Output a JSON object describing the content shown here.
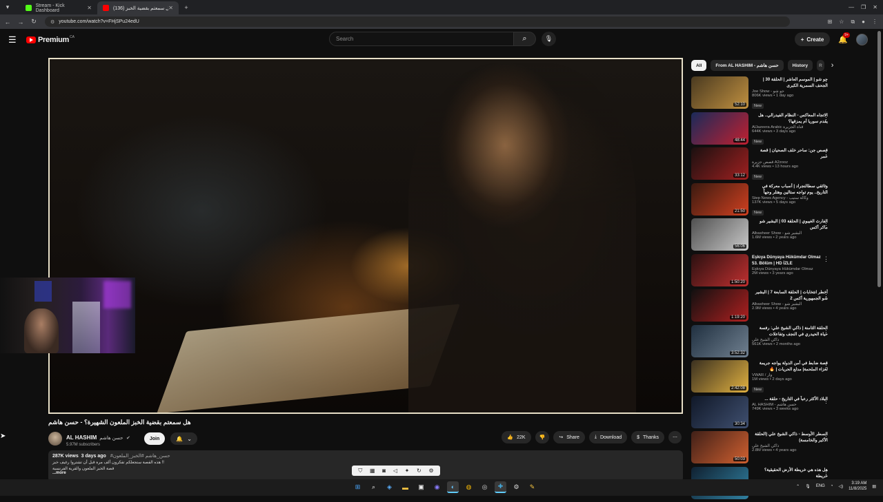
{
  "browser": {
    "tabs": [
      {
        "label": "Stream - Kick Dashboard",
        "active": false,
        "color": "#53fc18"
      },
      {
        "label": "(136) هل سمعتم بقضية الخبز ...",
        "active": true,
        "color": "#ff0000"
      }
    ],
    "url": "youtube.com/watch?v=FHjSPu24edU",
    "new_tab": "+"
  },
  "header": {
    "logo_text": "Premium",
    "logo_country": "CA",
    "search_placeholder": "Search",
    "create_label": "Create",
    "notifications_badge": "9+"
  },
  "video": {
    "title": "هل سمعتم بقضية الخبز الملعون الشهيرة؟ - حسن هاشم",
    "channel_name": "AL HASHIM",
    "channel_alt_name": "حسن هاشم",
    "subscribers": "5.97M subscribers",
    "join_label": "Join",
    "likes": "22K",
    "share_label": "Share",
    "download_label": "Download",
    "thanks_label": "Thanks",
    "views": "287K views",
    "age": "3 days ago",
    "tags": "#حسن_هاشم #الخبز_الملعون",
    "desc_line1": "هذه القصة ستجعلكم تفكرون ألف مرة قبل أن تشتروا رغيف خبز !!",
    "desc_line2": "قصة الخبز الملعون والقرية الفرنسية",
    "more_label": "...more"
  },
  "chips": [
    "All",
    "From AL HASHIM - حسن هاشم",
    "History",
    "R"
  ],
  "recommendations": [
    {
      "title": "جو شو | الموسم العاشر | الحلقة 30 | الجحف السمرية الكبرى",
      "channel": "Joe Show - جو شو",
      "meta": "806K views • 1 day ago",
      "duration": "52:10",
      "new": true,
      "thumb": [
        "#4a3a20",
        "#c09040"
      ]
    },
    {
      "title": "الاتجاه المعاكس - النظام الفيدرالي.. هل يقدم سوريا أم يمزقها؟",
      "channel": "AlJazeera Arabic قناة الجزيرة",
      "meta": "644K views • 3 days ago",
      "duration": "48:44",
      "new": true,
      "thumb": [
        "#1a2a5a",
        "#c02030"
      ]
    },
    {
      "title": "قصص جن: ساحر خلف الصحيان | قصة عمر",
      "channel": "قصص جزيرة A2zooz",
      "meta": "4.4K views • 13 hours ago",
      "duration": "33:12",
      "new": true,
      "thumb": [
        "#1a1010",
        "#a02020"
      ]
    },
    {
      "title": "وثائقي سطالنجراد | أسباب معركة في التاريخ.. يوم تواجه ستالين وهتلر وجهاً",
      "channel": "Step News Agency - وكالة ستيب",
      "meta": "137K views • 5 days ago",
      "duration": "21:50",
      "new": true,
      "thumb": [
        "#3a1a10",
        "#d04020"
      ]
    },
    {
      "title": "الفارث الغيبوي | الحلقة 03 | البشير شو ماكر أكس",
      "channel": "Albasheer Show - البشير شو",
      "meta": "1.6M views • 2 years ago",
      "duration": "56:06",
      "new": false,
      "thumb": [
        "#505050",
        "#c8c8c8"
      ]
    },
    {
      "title": "Eşkıya Dünyaya Hükümdar Olmaz 53. Bölüm | HD İZLE",
      "channel": "Eşkıya Dünyaya Hükümdar Olmaz",
      "meta": "2M views • 3 years ago",
      "duration": "1:50:20",
      "new": false,
      "thumb": [
        "#2a1010",
        "#c03030"
      ]
    },
    {
      "title": "أخطر انتخابات | الحلقة السابعة 7 | البشير شو الجمهورية أكس 2",
      "channel": "Albasheer Show - البشير شو",
      "meta": "2.9M views • 4 years ago",
      "duration": "1:19:20",
      "new": false,
      "thumb": [
        "#101010",
        "#b02020"
      ]
    },
    {
      "title": "الحلقة الثامنة | ذاكي الشيخ علي: رفسة حياة الحيدري في النجف وتفاعلات المعارضة العراقية",
      "channel": "ذاكي الشيخ علي",
      "meta": "561K views • 2 months ago",
      "duration": "3:52:32",
      "new": false,
      "thumb": [
        "#203040",
        "#708090"
      ]
    },
    {
      "title": "قصة ضابط في أمن الدولة يواجه جريمة لغزاء الملحمة| مدلع الحريات | 🔥",
      "channel": "VWAR / وار",
      "meta": "1M views • 2 days ago",
      "duration": "2:42:08",
      "new": true,
      "thumb": [
        "#3a3020",
        "#e0b040"
      ]
    },
    {
      "title": "البلاد الأكثر رعباً في التاريخ - حلقة ...",
      "channel": "AL HASHIM - حسن هاشم",
      "meta": "749K views • 3 weeks ago",
      "duration": "30:34",
      "new": false,
      "thumb": [
        "#101828",
        "#405070"
      ]
    },
    {
      "title": "السطر الأوسط - ذاكي الشيخ علي (الحلقة الأكبر والخامسة)",
      "channel": "ذاكي الشيخ علي",
      "meta": "2.8M views • 4 years ago",
      "duration": "50:03",
      "new": false,
      "thumb": [
        "#402018",
        "#d06030"
      ]
    },
    {
      "title": "هل هذه هي خريطة الأرض الحقيقية؟ خريطة",
      "channel": "",
      "meta": "",
      "duration": "",
      "new": false,
      "thumb": [
        "#102030",
        "#3080a0"
      ]
    }
  ],
  "taskbar": {
    "lang": "ENG",
    "time": "3:19 AM",
    "date": "11/8/2025"
  }
}
